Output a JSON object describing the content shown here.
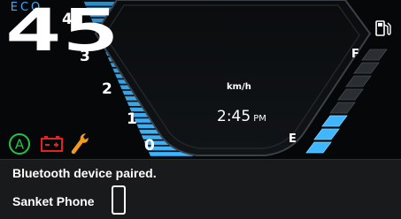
{
  "dashboard": {
    "ride_mode": "ECO",
    "speed": "45",
    "speed_unit": "km/h",
    "time": "2:45",
    "time_period": "PM",
    "battery_scale_labels": [
      "0",
      "1",
      "2",
      "3",
      "4"
    ],
    "fuel_labels": {
      "full": "F",
      "empty": "E"
    },
    "fuel_level_fraction": 0.375,
    "battery_level_fraction": 1.0,
    "indicators": [
      "auto-mode-icon",
      "battery-warning-icon",
      "service-wrench-icon",
      "fuel-pump-icon"
    ],
    "colors": {
      "bar_blue": "#3fb6ff",
      "indicator_green": "#27c24a",
      "warning_red": "#e52222",
      "service_orange": "#f39a1e"
    }
  },
  "notification": {
    "title": "Bluetooth device paired.",
    "device_name": "Sanket Phone",
    "icon": "smartphone-icon"
  }
}
